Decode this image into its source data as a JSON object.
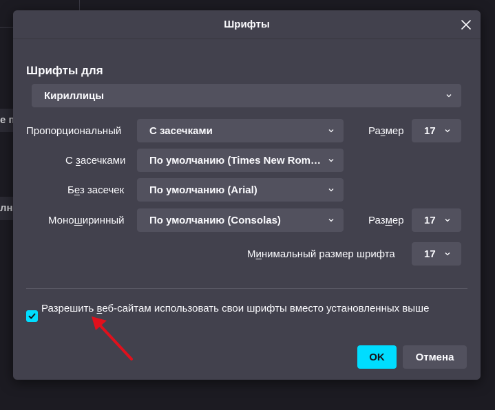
{
  "background": {
    "fragment_top": "е п",
    "fragment_bottom": "лн"
  },
  "dialog": {
    "title": "Шрифты",
    "fonts_for_heading": "Шрифты для",
    "script_select": "Кириллицы",
    "rows": {
      "proportional": {
        "label": "Пропорциональный",
        "value": "С засечками",
        "size_label_pre": "Ра",
        "size_label_ul": "з",
        "size_label_post": "мер",
        "size_value": "17"
      },
      "serif": {
        "label_pre": "С ",
        "label_ul": "з",
        "label_post": "асечками",
        "value": "По умолчанию (Times New Roman)"
      },
      "sans": {
        "label_pre": "Б",
        "label_ul": "е",
        "label_post": "з засечек",
        "value": "По умолчанию (Arial)"
      },
      "mono": {
        "label_pre": "Моно",
        "label_ul": "ш",
        "label_post": "иринный",
        "value": "По умолчанию (Consolas)",
        "size_label_pre": "Раз",
        "size_label_ul": "м",
        "size_label_post": "ер",
        "size_value": "17"
      },
      "minimum": {
        "label_pre": "М",
        "label_ul": "и",
        "label_post": "нимальный размер шрифта",
        "value": "17"
      }
    },
    "allow_pages_checkbox": {
      "checked": true,
      "label_pre": "Разрешить ",
      "label_ul": "в",
      "label_post": "еб-сайтам использовать свои шрифты вместо установленных выше"
    },
    "ok_label": "OK",
    "cancel_label": "Отмена"
  },
  "colors": {
    "dialog_bg": "#42414d",
    "control_bg": "#52515e",
    "accent": "#00ddff",
    "annotation_arrow": "#e0101c"
  },
  "icons": {
    "close": "close-icon",
    "chevron": "chevron-down-icon",
    "check": "checkmark-icon",
    "annotation": "arrow-annotation"
  }
}
